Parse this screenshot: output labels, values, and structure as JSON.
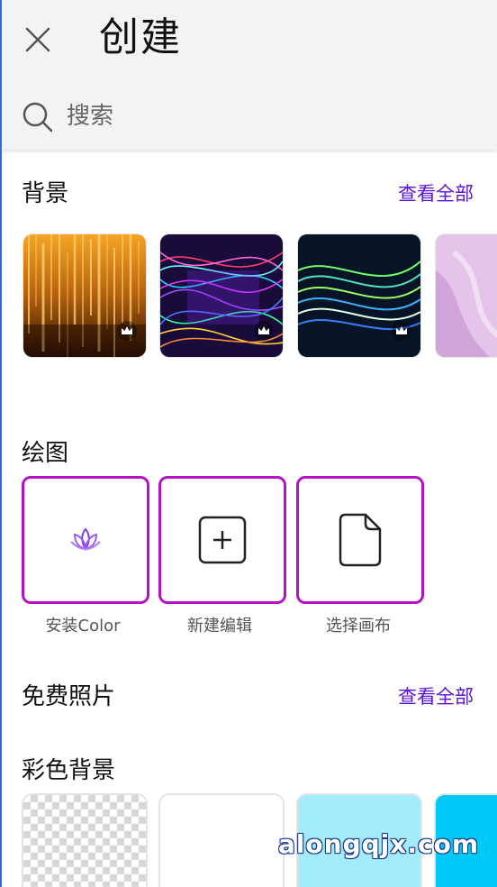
{
  "header": {
    "title": "创建",
    "search_placeholder": "搜索"
  },
  "sections": {
    "backgrounds": {
      "title": "背景",
      "see_all": "查看全部"
    },
    "draw": {
      "title": "绘图",
      "cards": [
        {
          "label": "安装Color",
          "icon": "lotus-icon"
        },
        {
          "label": "新建编辑",
          "icon": "plus-square-icon"
        },
        {
          "label": "选择画布",
          "icon": "document-icon"
        }
      ]
    },
    "free_photos": {
      "title": "免费照片",
      "see_all": "查看全部"
    },
    "color_backgrounds": {
      "title": "彩色背景",
      "tiles": [
        {
          "kind": "transparent"
        },
        {
          "color": "#ffffff"
        },
        {
          "color": "#a3ecfc"
        },
        {
          "color": "#00c8f8"
        }
      ]
    }
  },
  "colors": {
    "accent_link": "#5a12d4",
    "card_border": "#b313c0"
  },
  "watermark": "alongqjx.com"
}
